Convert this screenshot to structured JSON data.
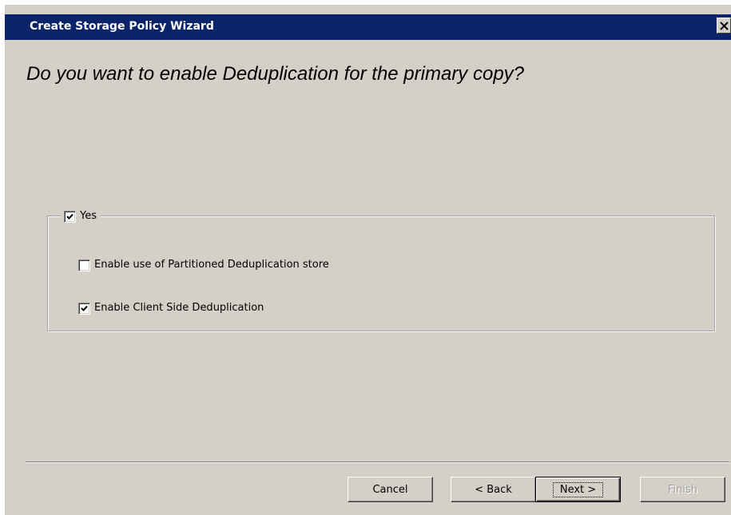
{
  "window": {
    "title": "Create Storage Policy Wizard",
    "close_icon": "close-x-icon"
  },
  "page": {
    "question": "Do you want to enable Deduplication for the primary copy?"
  },
  "options": {
    "yes": {
      "label": "Yes",
      "checked": true
    },
    "partitioned": {
      "label": "Enable use of Partitioned Deduplication store",
      "checked": false
    },
    "client_side": {
      "label": "Enable Client Side Deduplication",
      "checked": true
    }
  },
  "buttons": {
    "cancel": "Cancel",
    "back": "< Back",
    "next": "Next >",
    "finish": "Finish"
  },
  "colors": {
    "titlebar": "#0a246a",
    "face": "#d4d0c8",
    "disabled_text": "#a0a0a0"
  }
}
